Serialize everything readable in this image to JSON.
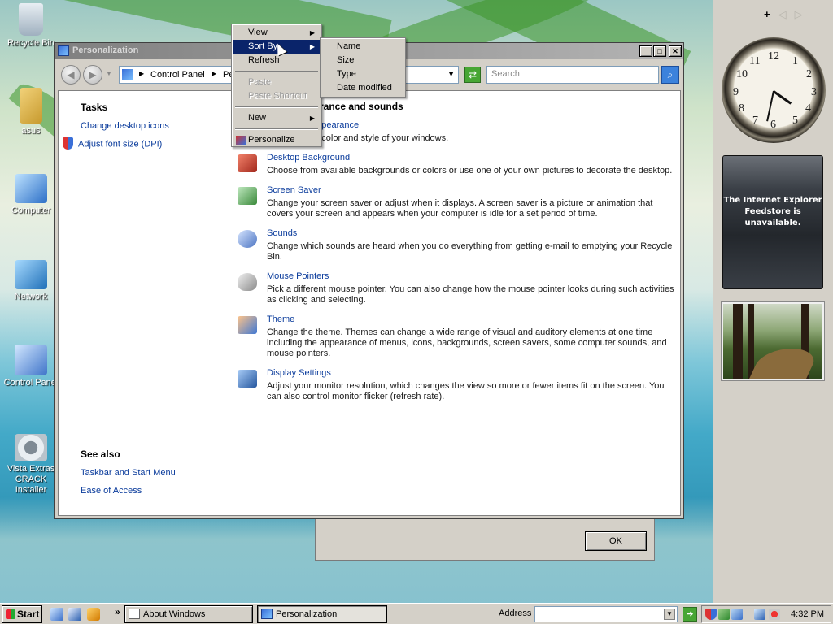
{
  "desktop": {
    "icons": [
      {
        "label": "Recycle Bin",
        "icon": "recycle-bin-icon",
        "color": "#a9b7c4"
      },
      {
        "label": "asus",
        "icon": "folder-icon",
        "color": "#d8b24a"
      },
      {
        "label": "Computer",
        "icon": "computer-icon",
        "color": "#4b8fd6"
      },
      {
        "label": "Network",
        "icon": "network-icon",
        "color": "#3aa0d8"
      },
      {
        "label": "Control Panel",
        "icon": "control-panel-icon",
        "color": "#4a7fd0"
      },
      {
        "label": "Vista Extras CRACK Installer",
        "icon": "installer-gear-icon",
        "color": "#cfd7de"
      }
    ]
  },
  "sidebar": {
    "add_label": "+",
    "prev_label": "◁",
    "next_label": "▷",
    "clock_numbers": [
      "12",
      "1",
      "2",
      "3",
      "4",
      "5",
      "6",
      "7",
      "8",
      "9",
      "10",
      "11"
    ],
    "ie_gadget_text": "The Internet Explorer Feedstore is unavailable."
  },
  "window": {
    "title": "Personalization",
    "min_label": "_",
    "max_label": "□",
    "close_label": "✕",
    "address": {
      "crumbs": [
        "Control Panel",
        "Pe"
      ]
    },
    "search_placeholder": "Search",
    "tasks": {
      "heading": "Tasks",
      "links": [
        "Change desktop icons",
        "Adjust font size (DPI)"
      ]
    },
    "see_also": {
      "heading": "See also",
      "links": [
        "Taskbar and Start Menu",
        "Ease of Access"
      ]
    },
    "main_heading": "rance and sounds",
    "items": [
      {
        "title": "and Appearance",
        "desc": "Fine tune the color and style of your windows.",
        "icon": "window-color-icon",
        "color": "#8aa6d8"
      },
      {
        "title": "Desktop Background",
        "desc": "Choose from available backgrounds or colors or use one of your own pictures to decorate the desktop.",
        "icon": "desktop-background-icon",
        "color": "#c94a3a"
      },
      {
        "title": "Screen Saver",
        "desc": "Change your screen saver or adjust when it displays. A screen saver is a picture or animation that covers your screen and appears when your computer is idle for a set period of time.",
        "icon": "screen-saver-icon",
        "color": "#5aa05a"
      },
      {
        "title": "Sounds",
        "desc": "Change which sounds are heard when you do everything from getting e-mail to emptying your Recycle Bin.",
        "icon": "sounds-icon",
        "color": "#5b86c9"
      },
      {
        "title": "Mouse Pointers",
        "desc": "Pick a different mouse pointer. You can also change how the mouse pointer looks during such activities as clicking and selecting.",
        "icon": "mouse-pointer-icon",
        "color": "#9a9a9a"
      },
      {
        "title": "Theme",
        "desc": "Change the theme. Themes can change a wide range of visual and auditory elements at one time including the appearance of menus, icons, backgrounds, screen savers, some computer sounds, and mouse pointers.",
        "icon": "theme-icon",
        "color": "#e08a3a"
      },
      {
        "title": "Display Settings",
        "desc": "Adjust your monitor resolution, which changes the view so more or fewer items fit on the screen. You can also control monitor flicker (refresh rate).",
        "icon": "display-settings-icon",
        "color": "#3f6fc8"
      }
    ]
  },
  "about_dialog": {
    "ok_label": "OK"
  },
  "context_menu": {
    "view": "View",
    "sort_by": "Sort By",
    "refresh": "Refresh",
    "paste": "Paste",
    "paste_shortcut": "Paste Shortcut",
    "new": "New",
    "personalize": "Personalize"
  },
  "submenu": {
    "items": [
      "Name",
      "Size",
      "Type",
      "Date modified"
    ]
  },
  "taskbar": {
    "start_label": "Start",
    "chevron": "»",
    "tasks": [
      "About Windows",
      "Personalization"
    ],
    "address_label": "Address",
    "time": "4:32 PM"
  }
}
